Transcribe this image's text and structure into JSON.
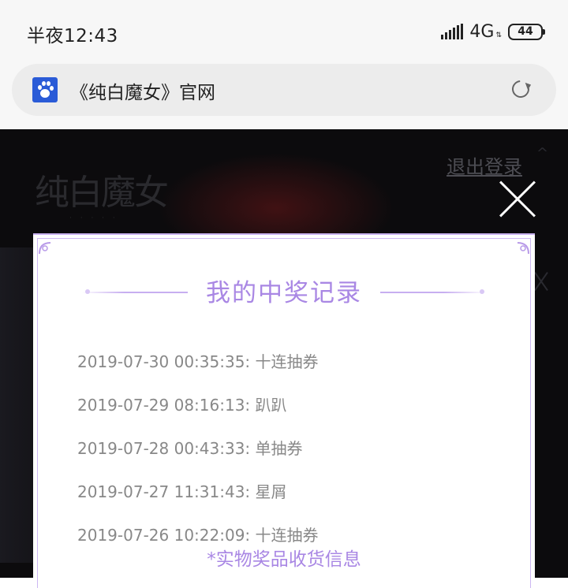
{
  "status_bar": {
    "time": "半夜12:43",
    "network": "4G",
    "battery": "44"
  },
  "browser": {
    "page_title": "《纯白魔女》官网",
    "site_icon": "baidu-paw-icon",
    "reload_icon": "reload-icon"
  },
  "page": {
    "logo_text": "纯白魔女",
    "logout_label": "退出登录"
  },
  "modal": {
    "title": "我的中奖记录",
    "records": [
      "2019-07-30 00:35:35: 十连抽券",
      "2019-07-29 08:16:13: 趴趴",
      "2019-07-28 00:43:33: 单抽券",
      "2019-07-27 11:31:43: 星屑",
      "2019-07-26 10:22:09: 十连抽券"
    ],
    "shipping_link": "*实物奖品收货信息",
    "accent_color": "#a987e4"
  }
}
